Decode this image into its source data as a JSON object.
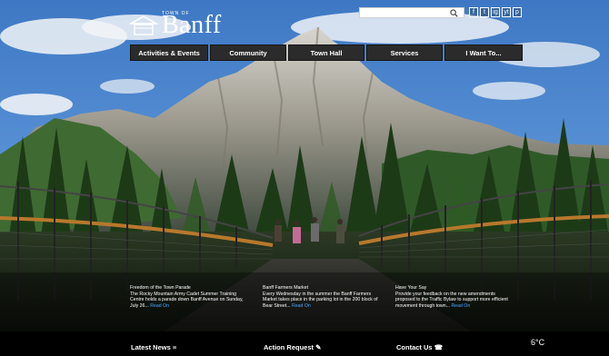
{
  "header": {
    "logo_text": "Banff",
    "logo_small": "TOWN OF",
    "search_placeholder": "",
    "social": [
      "f",
      "t",
      "ig",
      "yt",
      "p"
    ]
  },
  "nav": {
    "items": [
      {
        "label": "Activities & Events"
      },
      {
        "label": "Community"
      },
      {
        "label": "Town Hall"
      },
      {
        "label": "Services"
      },
      {
        "label": "I Want To..."
      }
    ]
  },
  "news": [
    {
      "title": "Freedom of the Town Parade",
      "body": "The Rocky Mountain Army Cadet Summer Training Centre holds a parade down Banff Avenue on Sunday, July 26...",
      "link": "Read On"
    },
    {
      "title": "Banff Farmers Market",
      "body": "Every Wednesday in the summer the Banff Farmers Market takes place in the parking lot in the 200 block of Bear Street...",
      "link": "Read On"
    },
    {
      "title": "Have Your Say",
      "body": "Provide your feedback on the new amendments proposed to the Traffic Bylaw to support more efficient movement through town...",
      "link": "Read On"
    }
  ],
  "footer": {
    "latest_news": "Latest News",
    "action_request": "Action Request",
    "contact_us": "Contact Us",
    "temperature": "6°C"
  },
  "colors": {
    "nav_bg": "#2b2b2b",
    "link": "#4aa8ff",
    "footer_bg": "#000000"
  }
}
